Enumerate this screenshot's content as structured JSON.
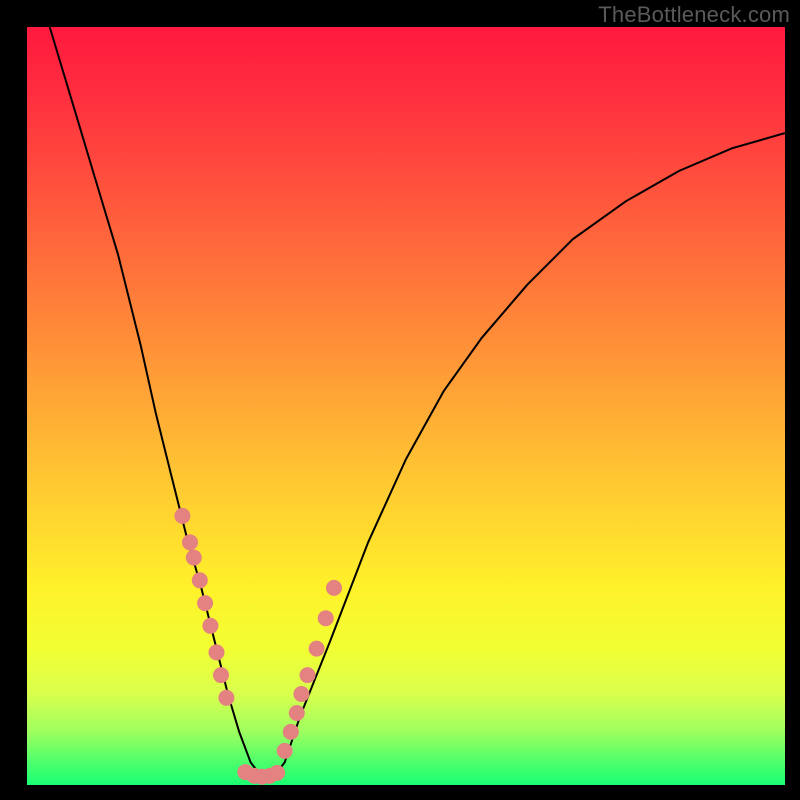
{
  "watermark": "TheBottleneck.com",
  "colors": {
    "dot": "#e48181",
    "curve": "#000000",
    "frame": "#000000"
  },
  "chart_data": {
    "type": "line",
    "title": "",
    "xlabel": "",
    "ylabel": "",
    "xlim": [
      0,
      100
    ],
    "ylim": [
      0,
      100
    ],
    "grid": false,
    "series": [
      {
        "name": "bottleneck-curve",
        "x": [
          3,
          6,
          9,
          12,
          15,
          17,
          19,
          21,
          23,
          25,
          26.5,
          28,
          29.5,
          31,
          32.5,
          34,
          36,
          40,
          45,
          50,
          55,
          60,
          66,
          72,
          79,
          86,
          93,
          100
        ],
        "y": [
          100,
          90,
          80,
          70,
          58,
          49,
          41,
          33,
          26,
          18,
          12,
          7,
          3,
          1,
          1,
          3,
          9,
          19,
          32,
          43,
          52,
          59,
          66,
          72,
          77,
          81,
          84,
          86
        ]
      }
    ],
    "scatter": {
      "name": "highlighted-points",
      "x": [
        20.5,
        21.5,
        22.0,
        22.8,
        23.5,
        24.2,
        25.0,
        25.6,
        26.3,
        28.8,
        30.0,
        31.0,
        32.0,
        33.0,
        34.0,
        34.8,
        35.6,
        36.2,
        37.0,
        38.2,
        39.4,
        40.5
      ],
      "y": [
        35.5,
        32.0,
        30.0,
        27.0,
        24.0,
        21.0,
        17.5,
        14.5,
        11.5,
        1.7,
        1.2,
        1.1,
        1.2,
        1.6,
        4.5,
        7.0,
        9.5,
        12.0,
        14.5,
        18.0,
        22.0,
        26.0
      ]
    }
  }
}
